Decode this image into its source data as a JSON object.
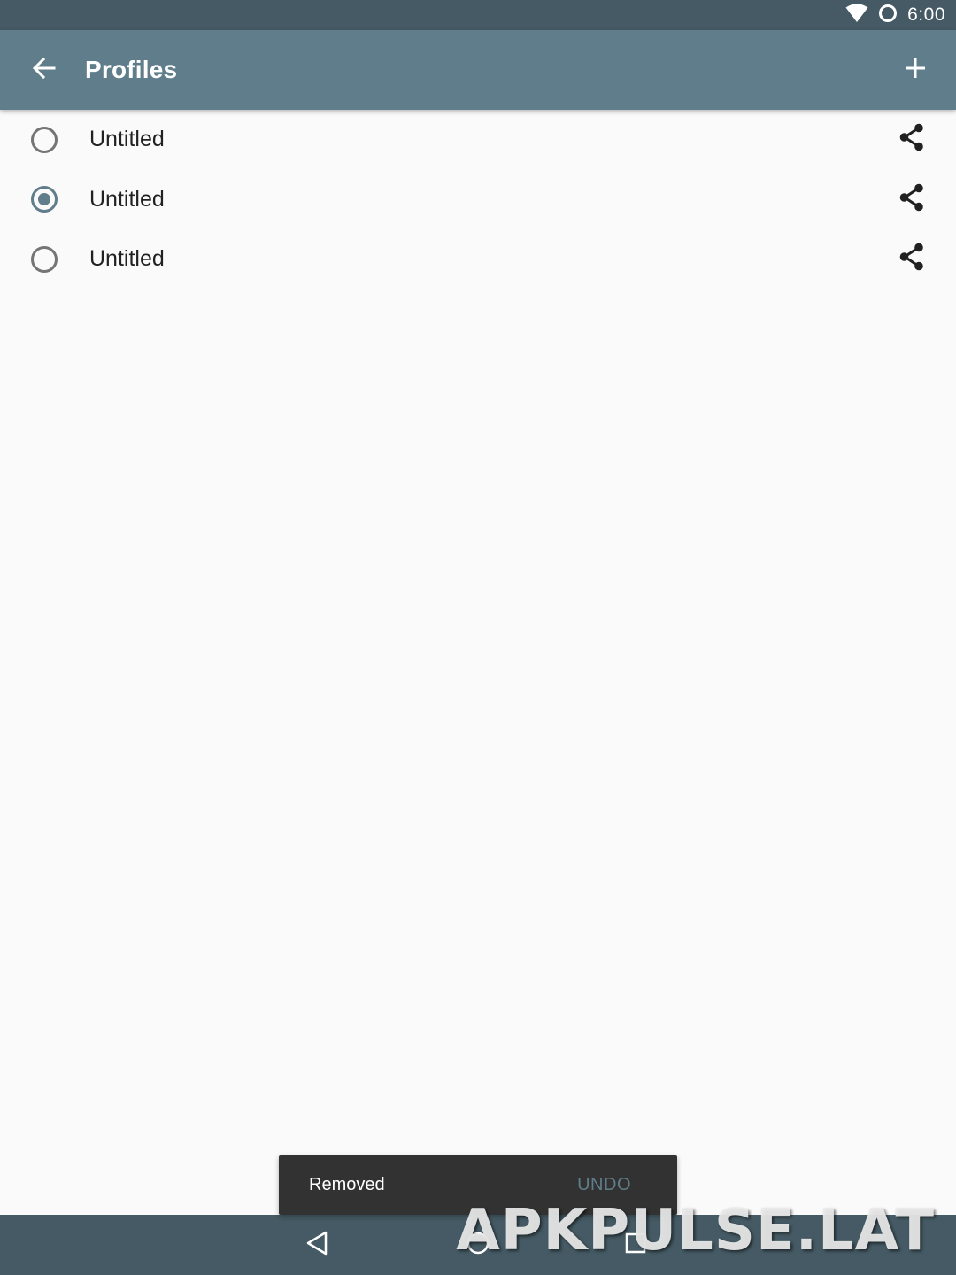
{
  "status_bar": {
    "time": "6:00",
    "icons": [
      "wifi-icon",
      "sync-circle-icon"
    ]
  },
  "app_bar": {
    "title": "Profiles",
    "back_icon": "arrow-back-icon",
    "add_icon": "plus-icon"
  },
  "profiles": [
    {
      "label": "Untitled",
      "selected": false,
      "action_icon": "share-icon"
    },
    {
      "label": "Untitled",
      "selected": true,
      "action_icon": "share-icon"
    },
    {
      "label": "Untitled",
      "selected": false,
      "action_icon": "share-icon"
    }
  ],
  "snackbar": {
    "message": "Removed",
    "action": "UNDO"
  },
  "nav_bar": {
    "icons": [
      "back-triangle-icon",
      "home-circle-icon",
      "recents-square-icon"
    ]
  },
  "watermark": "APKPULSE.LAT",
  "colors": {
    "status_bar": "#455a64",
    "app_bar": "#607d8b",
    "accent": "#607d8b",
    "background": "#fafafa",
    "snackbar": "#323232"
  }
}
